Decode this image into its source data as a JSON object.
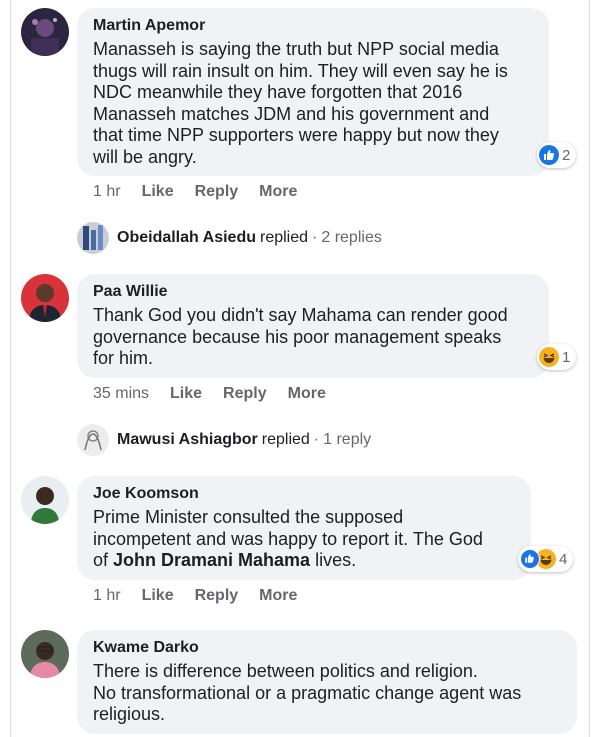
{
  "comments": [
    {
      "author": "Martin Apemor",
      "lines": [
        "Manasseh is saying the truth but NPP social media",
        "thugs will rain insult on him. They will even say he is",
        "NDC meanwhile they have forgotten that 2016",
        "Manasseh matches JDM and his government and",
        "that time NPP supporters were happy but now they",
        "will be angry."
      ],
      "time": "1 hr",
      "reaction_count": "2",
      "reaction_icons": [
        "like-icon"
      ]
    },
    {
      "author": "Paa Willie",
      "lines": [
        "Thank God you didn't say Mahama can render good",
        "governance because his poor management speaks",
        "for him."
      ],
      "time": "35 mins",
      "reaction_count": "1",
      "reaction_icons": [
        "haha-icon"
      ]
    },
    {
      "author": "Joe Koomson",
      "lines": [
        "Prime Minister consulted the supposed",
        "incompetent and was happy to report it. The God"
      ],
      "line3_prefix": "of ",
      "line3_bold": "John Dramani Mahama",
      "line3_suffix": " lives.",
      "time": "1 hr",
      "reaction_count": "4",
      "reaction_icons": [
        "like-icon",
        "haha-icon"
      ]
    },
    {
      "author": "Kwame Darko",
      "lines": [
        "There is difference between politics and religion.",
        "No transformational or a pragmatic change agent was",
        "religious."
      ]
    }
  ],
  "actions": {
    "like": "Like",
    "reply": "Reply",
    "more": "More"
  },
  "replied_threads": [
    {
      "name": "Obeidallah Asiedu",
      "word": "replied",
      "dot": "·",
      "count": "2 replies"
    },
    {
      "name": "Mawusi Ashiagbor",
      "word": "replied",
      "dot": "·",
      "count": "1 reply"
    }
  ],
  "colors": {
    "like": "#1b74e4",
    "haha": "#f7b125",
    "bubble": "#f0f2f5",
    "meta": "#65676b"
  }
}
